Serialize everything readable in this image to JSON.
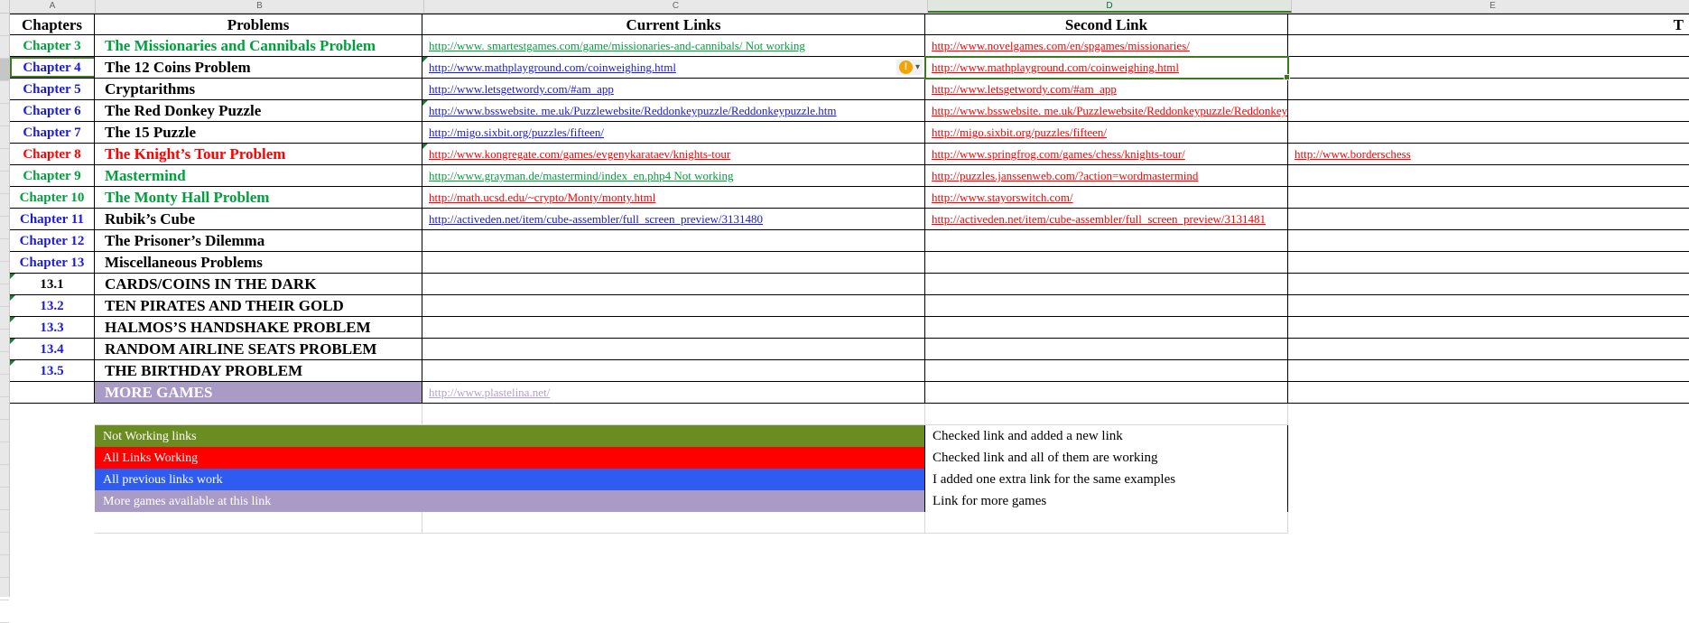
{
  "spreadsheet": {
    "column_headers": [
      "A",
      "B",
      "C",
      "D",
      "E"
    ],
    "selected_column": "D",
    "table_headers": {
      "a": "Chapters",
      "b": "Problems",
      "c": "Current Links",
      "d": "Second Link",
      "e": "T"
    },
    "rows": [
      {
        "chapter": "Chapter 3",
        "chapter_color": "green",
        "problem": "The Missionaries and Cannibals Problem",
        "problem_color": "green",
        "current_link": "http://www. smartestgames.com/game/missionaries-and-cannibals/ Not working",
        "current_link_color": "green",
        "current_comment": false,
        "second_link": "http://www.novelgames.com/en/spgames/missionaries/",
        "second_link_color": "red",
        "third_link": ""
      },
      {
        "chapter": "Chapter 4",
        "chapter_color": "blue",
        "problem": "The 12 Coins Problem",
        "problem_color": "black",
        "current_link": "http://www.mathplayground.com/coinweighing.html ",
        "current_link_color": "blue",
        "current_comment": true,
        "second_link": "http://www.mathplayground.com/coinweighing.html ",
        "second_link_color": "red",
        "third_link": ""
      },
      {
        "chapter": "Chapter 5",
        "chapter_color": "blue",
        "problem": "Cryptarithms",
        "problem_color": "black",
        "current_link": "http://www.letsgetwordy.com/#am_app",
        "current_link_color": "blue",
        "current_comment": false,
        "second_link": "http://www.letsgetwordy.com/#am_app",
        "second_link_color": "red",
        "third_link": ""
      },
      {
        "chapter": "Chapter 6",
        "chapter_color": "blue",
        "problem": "The Red Donkey Puzzle",
        "problem_color": "black",
        "current_link": " http://www.bsswebsite. me.uk/Puzzlewebsite/Reddonkeypuzzle/Reddonkeypuzzle.htm",
        "current_link_color": "blue",
        "current_comment": true,
        "second_link": " http://www.bsswebsite. me.uk/Puzzlewebsite/Reddonkeypuzzle/Reddonkeypuzzle.htm",
        "second_link_color": "red",
        "third_link": ""
      },
      {
        "chapter": "Chapter 7",
        "chapter_color": "blue",
        "problem": "The 15 Puzzle",
        "problem_color": "black",
        "current_link": "http://migo.sixbit.org/puzzles/fifteen/",
        "current_link_color": "blue",
        "current_comment": false,
        "second_link": "http://migo.sixbit.org/puzzles/fifteen/",
        "second_link_color": "red",
        "third_link": ""
      },
      {
        "chapter": "Chapter 8",
        "chapter_color": "red",
        "problem": "The Knight’s Tour Problem",
        "problem_color": "red",
        "current_link": " http://www.kongregate.com/games/evgenykarataev/knights-tour",
        "current_link_color": "red",
        "current_comment": true,
        "second_link": "http://www.springfrog.com/games/chess/knights-tour/",
        "second_link_color": "red",
        "third_link": "http://www.borderschess"
      },
      {
        "chapter": "Chapter 9",
        "chapter_color": "green",
        "problem": "Mastermind",
        "problem_color": "green",
        "current_link": "http://www.grayman.de/mastermind/index_en.php4 Not working",
        "current_link_color": "green",
        "current_comment": false,
        "second_link": "http://puzzles.janssenweb.com/?action=wordmastermind",
        "second_link_color": "red",
        "third_link": ""
      },
      {
        "chapter": "Chapter 10",
        "chapter_color": "green",
        "problem": "The Monty Hall Problem",
        "problem_color": "green",
        "current_link": "http://math.ucsd.edu/~crypto/Monty/monty.html",
        "current_link_color": "red",
        "current_comment": false,
        "second_link": "http://www.stayorswitch.com/",
        "second_link_color": "red",
        "third_link": ""
      },
      {
        "chapter": "Chapter 11",
        "chapter_color": "blue",
        "problem": "Rubik’s Cube",
        "problem_color": "black",
        "current_link": "http://activeden.net/item/cube-assembler/full_screen_preview/3131480",
        "current_link_color": "blue",
        "current_comment": false,
        "second_link": "http://activeden.net/item/cube-assembler/full_screen_preview/3131481",
        "second_link_color": "red",
        "third_link": ""
      },
      {
        "chapter": "Chapter 12",
        "chapter_color": "blue",
        "problem": "The Prisoner’s Dilemma",
        "problem_color": "black",
        "current_link": "",
        "current_link_color": "blue",
        "current_comment": false,
        "second_link": "",
        "second_link_color": "red",
        "third_link": ""
      },
      {
        "chapter": "Chapter 13",
        "chapter_color": "blue",
        "problem": "Miscellaneous Problems",
        "problem_color": "black",
        "current_link": "",
        "current_link_color": "blue",
        "current_comment": false,
        "second_link": "",
        "second_link_color": "red",
        "third_link": ""
      },
      {
        "chapter": "13.1",
        "chapter_color": "black",
        "problem": "CARDS/COINS IN THE DARK",
        "problem_color": "black",
        "current_link": "",
        "current_link_color": "blue",
        "current_comment": false,
        "second_link": "",
        "second_link_color": "red",
        "third_link": "",
        "chapter_comment": true
      },
      {
        "chapter": "13.2",
        "chapter_color": "blue",
        "problem": "TEN PIRATES AND THEIR GOLD",
        "problem_color": "black",
        "current_link": "",
        "current_link_color": "blue",
        "current_comment": false,
        "second_link": "",
        "second_link_color": "red",
        "third_link": "",
        "chapter_comment": true
      },
      {
        "chapter": "13.3",
        "chapter_color": "blue",
        "problem": "HALMOS’S HANDSHAKE PROBLEM",
        "problem_color": "black",
        "current_link": "",
        "current_link_color": "blue",
        "current_comment": false,
        "second_link": "",
        "second_link_color": "red",
        "third_link": "",
        "chapter_comment": true
      },
      {
        "chapter": "13.4",
        "chapter_color": "blue",
        "problem": "RANDOM AIRLINE SEATS PROBLEM",
        "problem_color": "black",
        "current_link": "",
        "current_link_color": "blue",
        "current_comment": false,
        "second_link": "",
        "second_link_color": "red",
        "third_link": "",
        "chapter_comment": true
      },
      {
        "chapter": "13.5",
        "chapter_color": "blue",
        "problem": "THE BIRTHDAY PROBLEM",
        "problem_color": "black",
        "current_link": "",
        "current_link_color": "blue",
        "current_comment": false,
        "second_link": "",
        "second_link_color": "red",
        "third_link": "",
        "chapter_comment": true
      },
      {
        "chapter": "",
        "chapter_color": "black",
        "problem": "MORE GAMES",
        "problem_color": "white",
        "problem_fill": "#a99ac6",
        "current_link": "http://www.plastelina.net/",
        "current_link_color": "purple",
        "current_comment": false,
        "second_link": "",
        "second_link_color": "red",
        "third_link": ""
      }
    ],
    "legend": [
      {
        "label": "Not Working links",
        "color": "#6b8c21",
        "description": "Checked link and added a new link"
      },
      {
        "label": "All Links Working",
        "color": "#fe0000",
        "description": "Checked link and all of them are working"
      },
      {
        "label": "All previous links work",
        "color": "#2f5cf0",
        "description": "I added one extra link for the same examples"
      },
      {
        "label": "More games available at  this link",
        "color": "#a99ac6",
        "description": "Link for more games"
      }
    ],
    "icons": {
      "warning": "!",
      "dropdown": "⌄"
    },
    "colors": {
      "green_text": "#00a03c",
      "blue_text": "#1a1adb",
      "red_text": "#ff0000",
      "purple_fill": "#a99ac6",
      "selection_border": "#3c7a1e",
      "warning_badge": "#f0a500"
    }
  }
}
